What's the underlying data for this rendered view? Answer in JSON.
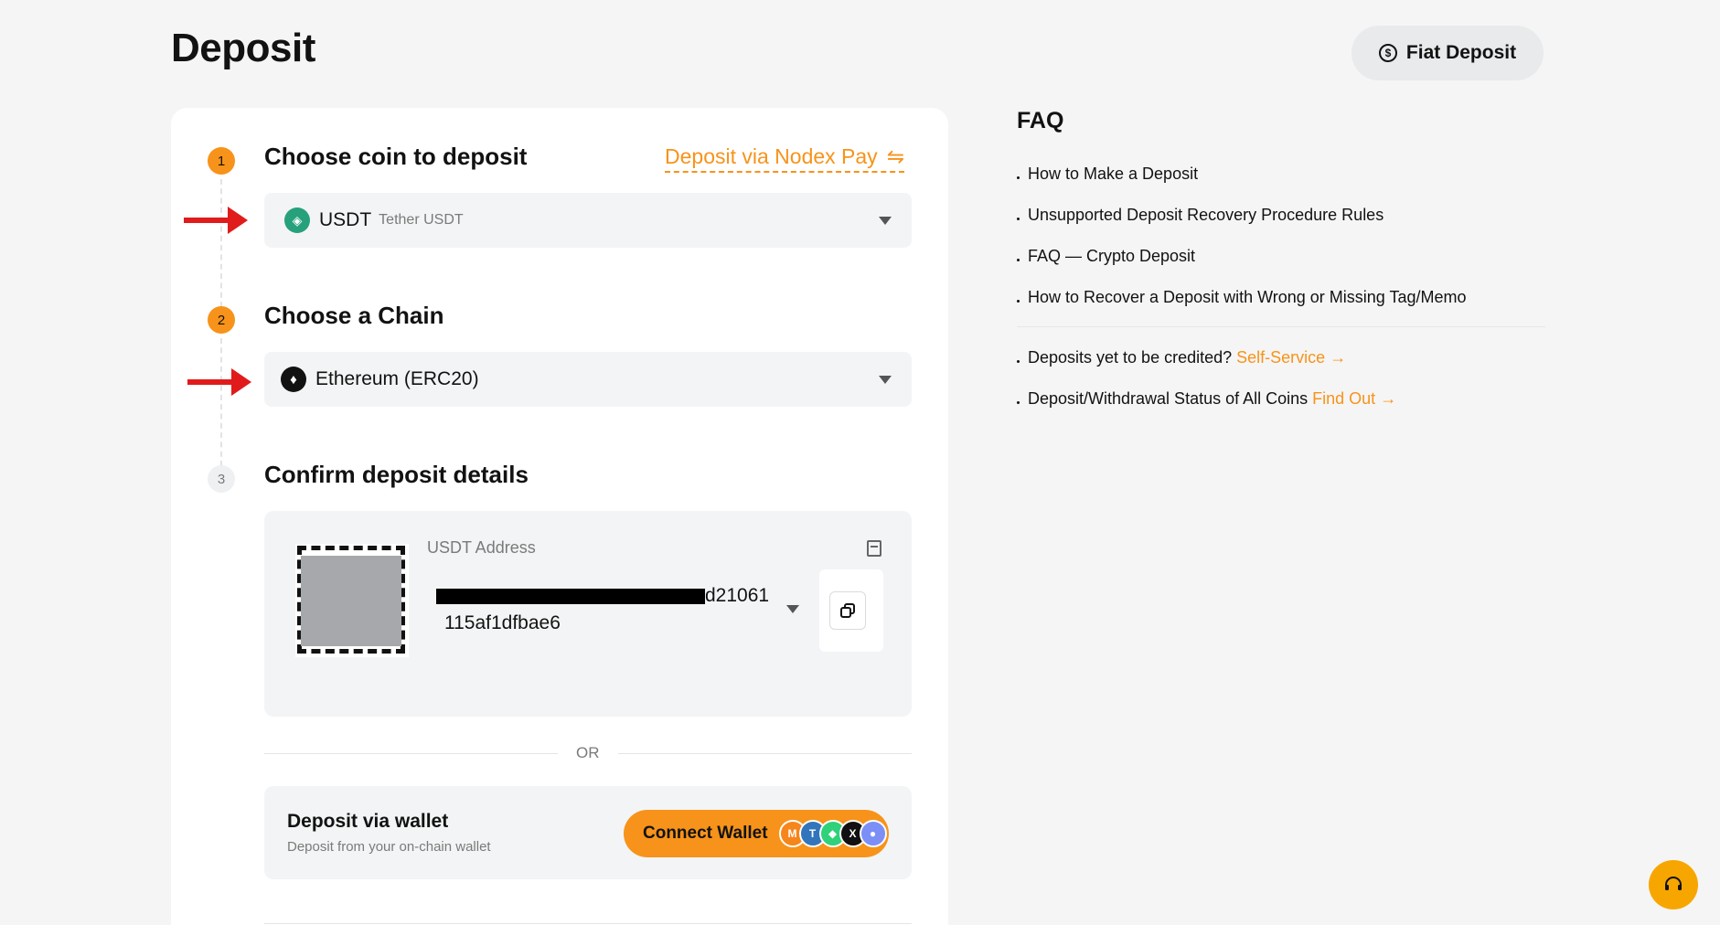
{
  "header": {
    "title": "Deposit",
    "fiat_button": "Fiat Deposit"
  },
  "steps": [
    {
      "number": "1",
      "title": "Choose coin to deposit"
    },
    {
      "number": "2",
      "title": "Choose a Chain"
    },
    {
      "number": "3",
      "title": "Confirm deposit details"
    }
  ],
  "nodex_link": "Deposit via Nodex Pay",
  "coin_select": {
    "symbol": "USDT",
    "name": "Tether USDT",
    "icon": "tether-icon"
  },
  "chain_select": {
    "value": "Ethereum (ERC20)",
    "icon": "ethereum-icon"
  },
  "details": {
    "address_label": "USDT Address",
    "address_line1_visible": "d21061",
    "address_line2": "115af1dfbae6"
  },
  "or_text": "OR",
  "wallet": {
    "title": "Deposit via wallet",
    "subtitle": "Deposit from your on-chain wallet",
    "button": "Connect Wallet"
  },
  "faq": {
    "title": "FAQ",
    "items": [
      "How to Make a Deposit",
      "Unsupported Deposit Recovery Procedure Rules",
      "FAQ — Crypto Deposit",
      "How to Recover a Deposit with Wrong or Missing Tag/Memo"
    ],
    "extra": [
      {
        "text": "Deposits yet to be credited?",
        "link": "Self-Service"
      },
      {
        "text": "Deposit/Withdrawal Status of All Coins",
        "link": "Find Out"
      }
    ]
  },
  "colors": {
    "accent": "#f7931a",
    "annotation_arrow": "#e11b1b",
    "tether": "#26a17b"
  }
}
